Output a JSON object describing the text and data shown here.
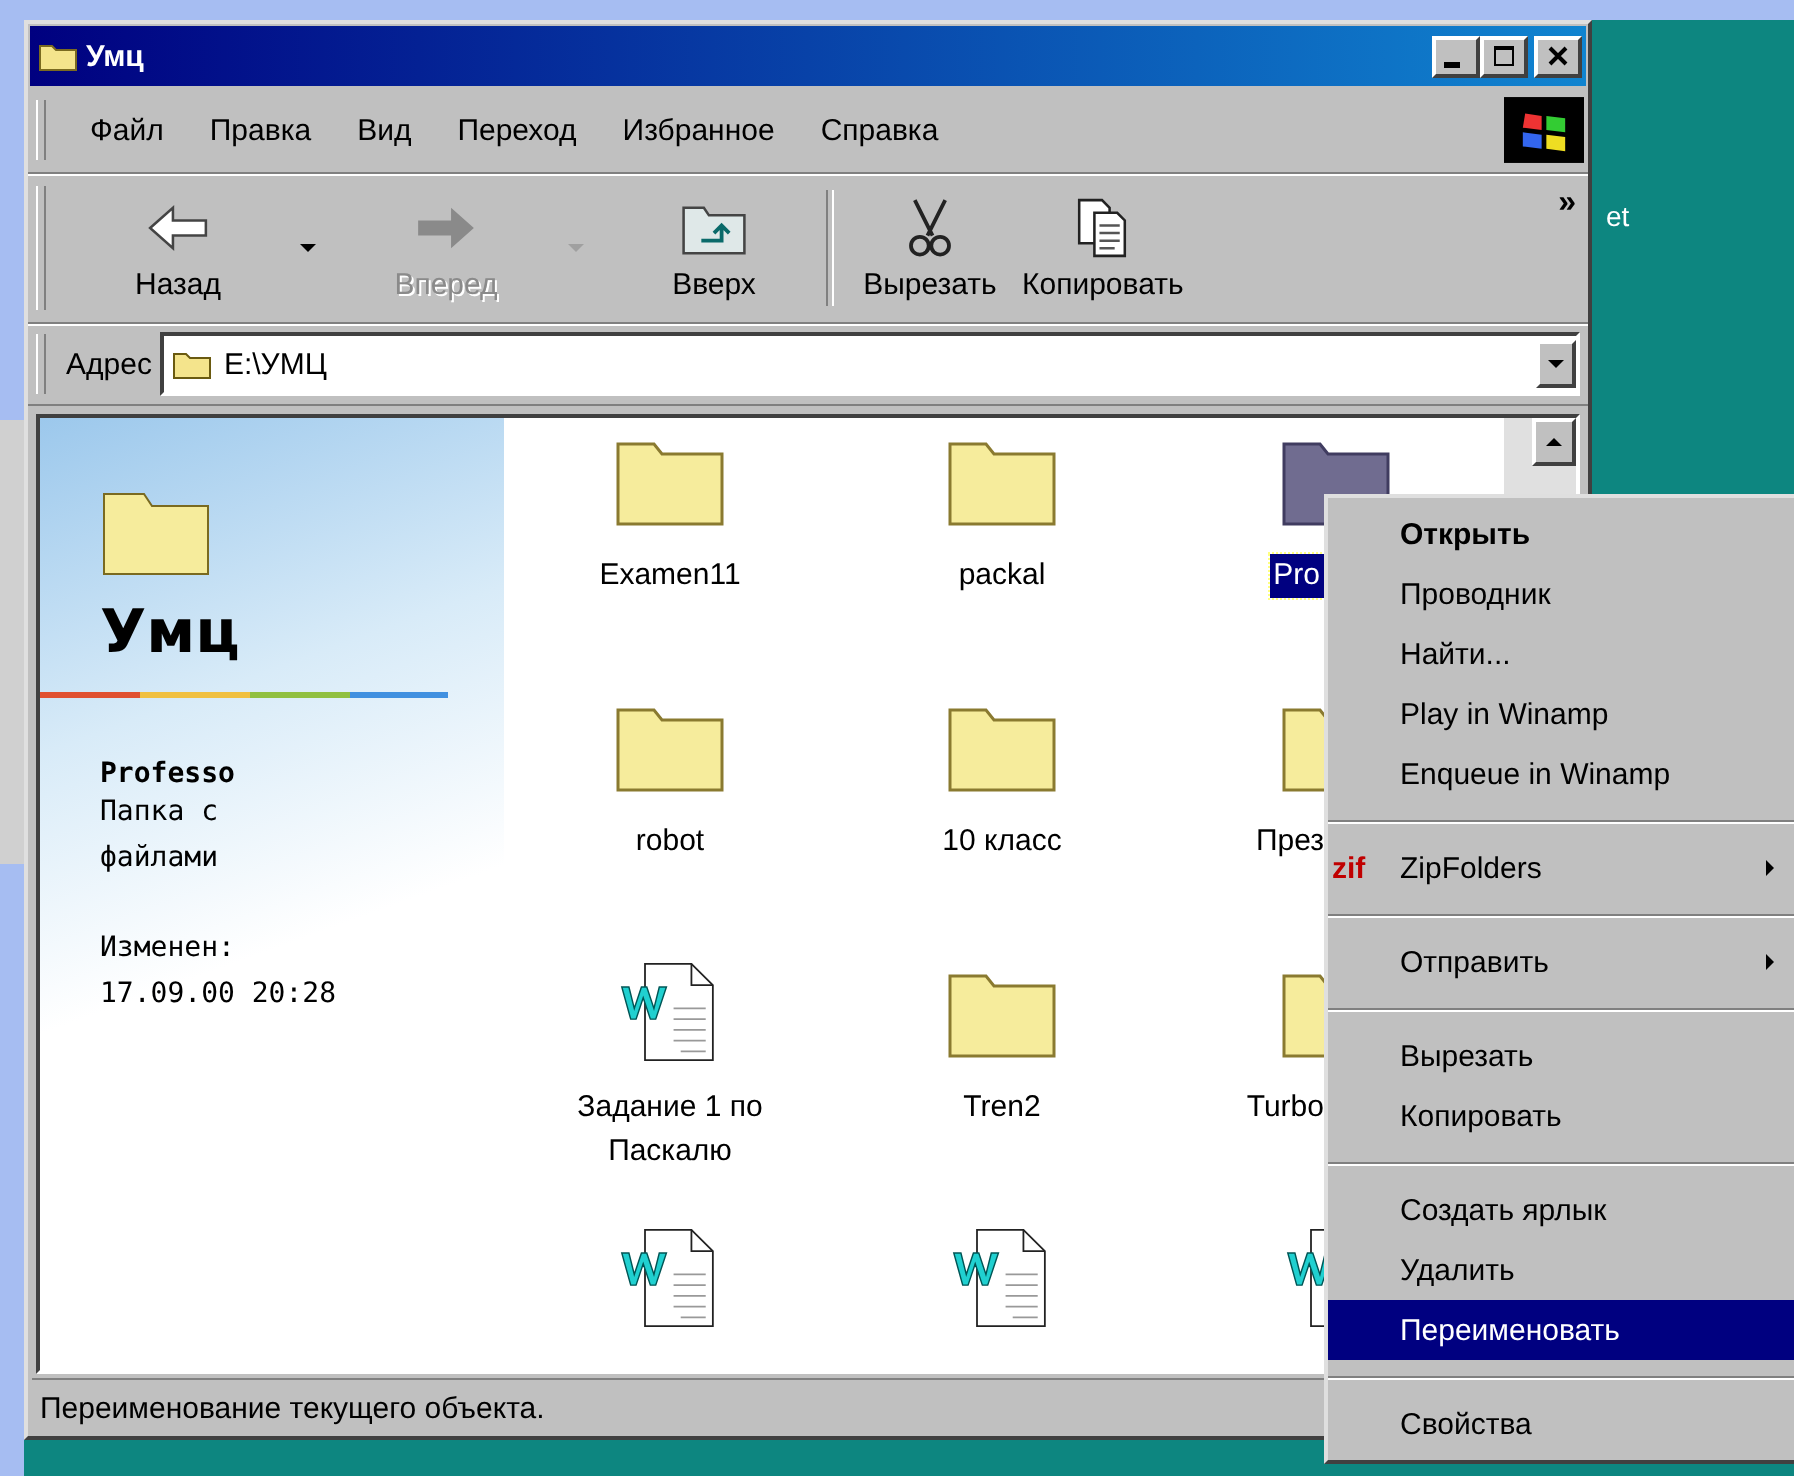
{
  "window": {
    "title": "Умц"
  },
  "menu_bar": [
    {
      "label": "Файл"
    },
    {
      "label": "Правка"
    },
    {
      "label": "Вид"
    },
    {
      "label": "Переход"
    },
    {
      "label": "Избранное"
    },
    {
      "label": "Справка"
    }
  ],
  "toolbar": {
    "buttons": [
      {
        "kind": "back",
        "label": "Назад",
        "disabled": false,
        "dropdown": true
      },
      {
        "kind": "forward",
        "label": "Вперед",
        "disabled": true,
        "dropdown": true
      },
      {
        "kind": "up",
        "label": "Вверх",
        "disabled": false,
        "dropdown": false
      },
      {
        "kind": "cut",
        "label": "Вырезать",
        "disabled": false,
        "dropdown": false
      },
      {
        "kind": "copy",
        "label": "Копировать",
        "disabled": false,
        "dropdown": false
      }
    ],
    "overflow": "»"
  },
  "address": {
    "label": "Адрес",
    "value": "E:\\УМЦ"
  },
  "info_pane": {
    "title": "Умц",
    "name": "Professo",
    "type": "Папка с файлами",
    "modified_label": "Изменен:",
    "modified": "17.09.00 20:28"
  },
  "items": [
    {
      "kind": "folder",
      "label": "Examen11",
      "selected": false
    },
    {
      "kind": "folder",
      "label": "packal",
      "selected": false
    },
    {
      "kind": "folder",
      "label": "Pro",
      "selected": true
    },
    {
      "kind": "folder",
      "label": "robot",
      "selected": false
    },
    {
      "kind": "folder",
      "label": "10 класс",
      "selected": false
    },
    {
      "kind": "folder",
      "label": "През",
      "selected": false
    },
    {
      "kind": "document",
      "label": "Задание 1 по Паскалю",
      "selected": false
    },
    {
      "kind": "folder",
      "label": "Tren2",
      "selected": false
    },
    {
      "kind": "folder",
      "label": "Turbo",
      "selected": false
    },
    {
      "kind": "document",
      "selected": false
    },
    {
      "kind": "document",
      "selected": false
    },
    {
      "kind": "document",
      "selected": false
    }
  ],
  "status_bar": "Переименование текущего объекта.",
  "desktop_label": "et",
  "context_menu": [
    {
      "kind": "item",
      "label": "Открыть",
      "bold": true,
      "selected": false
    },
    {
      "kind": "item",
      "label": "Проводник",
      "selected": false
    },
    {
      "kind": "item",
      "label": "Найти...",
      "selected": false
    },
    {
      "kind": "item",
      "label": "Play in Winamp",
      "selected": false
    },
    {
      "kind": "item",
      "label": "Enqueue in Winamp",
      "selected": false
    },
    {
      "kind": "separator"
    },
    {
      "kind": "item",
      "label": "ZipFolders",
      "badge": "zif",
      "submenu": true,
      "selected": false
    },
    {
      "kind": "separator"
    },
    {
      "kind": "item",
      "label": "Отправить",
      "submenu": true,
      "selected": false
    },
    {
      "kind": "separator"
    },
    {
      "kind": "item",
      "label": "Вырезать",
      "selected": false
    },
    {
      "kind": "item",
      "label": "Копировать",
      "selected": false
    },
    {
      "kind": "separator"
    },
    {
      "kind": "item",
      "label": "Создать ярлык",
      "selected": false
    },
    {
      "kind": "item",
      "label": "Удалить",
      "selected": false
    },
    {
      "kind": "item",
      "label": "Переименовать",
      "selected": true
    },
    {
      "kind": "separator"
    },
    {
      "kind": "item",
      "label": "Свойства",
      "selected": false
    }
  ]
}
